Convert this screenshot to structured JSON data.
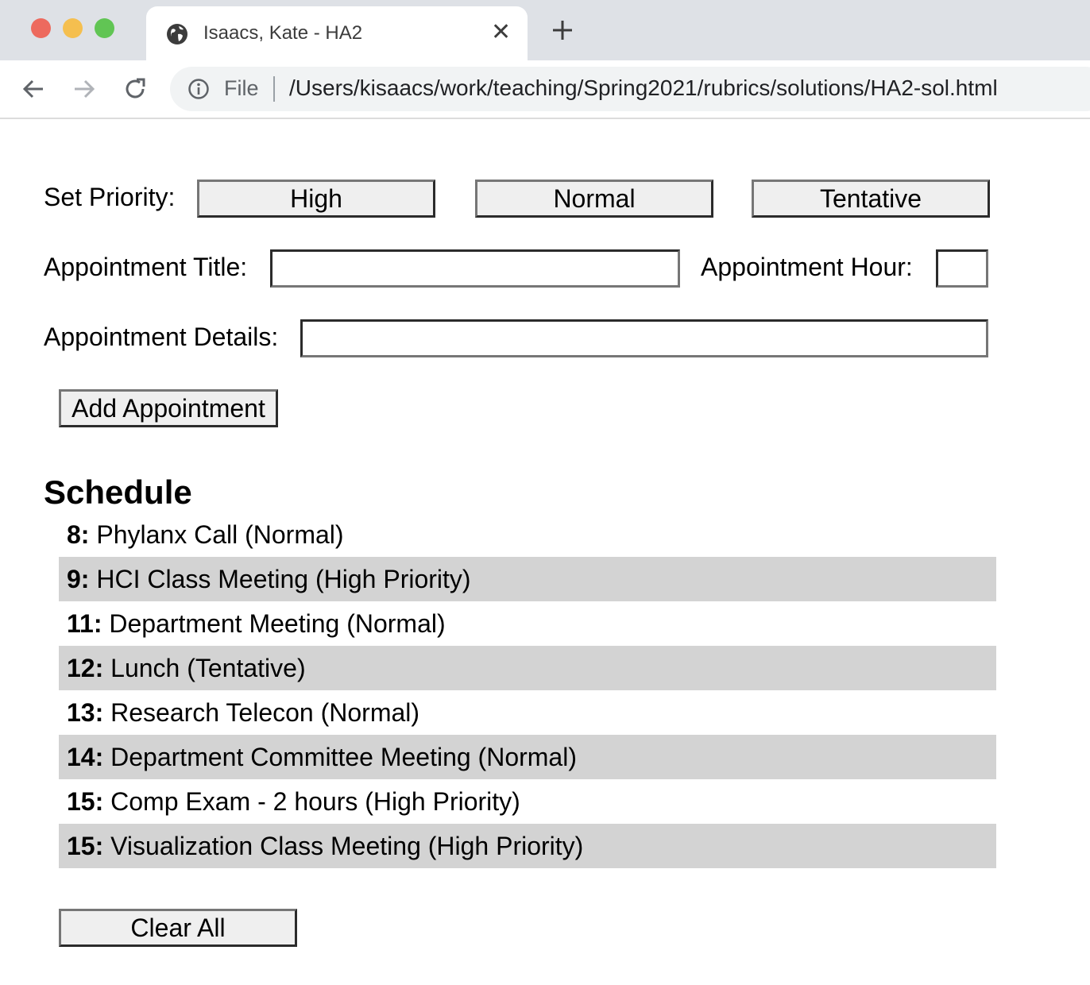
{
  "browser": {
    "tab_title": "Isaacs, Kate - HA2",
    "scheme": "File",
    "url": "/Users/kisaacs/work/teaching/Spring2021/rubrics/solutions/HA2-sol.html"
  },
  "form": {
    "priority_label": "Set Priority:",
    "priority_buttons": [
      "High",
      "Normal",
      "Tentative"
    ],
    "title_label": "Appointment Title:",
    "title_value": "",
    "hour_label": "Appointment Hour:",
    "hour_value": "",
    "details_label": "Appointment Details:",
    "details_value": "",
    "add_button": "Add Appointment"
  },
  "schedule": {
    "heading": "Schedule",
    "items": [
      {
        "hour": "8:",
        "text": " Phylanx Call (Normal)"
      },
      {
        "hour": "9:",
        "text": " HCI Class Meeting (High Priority)"
      },
      {
        "hour": "11:",
        "text": " Department Meeting (Normal)"
      },
      {
        "hour": "12:",
        "text": " Lunch (Tentative)"
      },
      {
        "hour": "13:",
        "text": " Research Telecon (Normal)"
      },
      {
        "hour": "14:",
        "text": " Department Committee Meeting (Normal)"
      },
      {
        "hour": "15:",
        "text": " Comp Exam - 2 hours (High Priority)"
      },
      {
        "hour": "15:",
        "text": " Visualization Class Meeting (High Priority)"
      }
    ],
    "clear_button": "Clear All"
  },
  "colors": {
    "stripe": "#d3d3d3",
    "button_bg": "#efefef",
    "tabbar_bg": "#dee1e6"
  }
}
